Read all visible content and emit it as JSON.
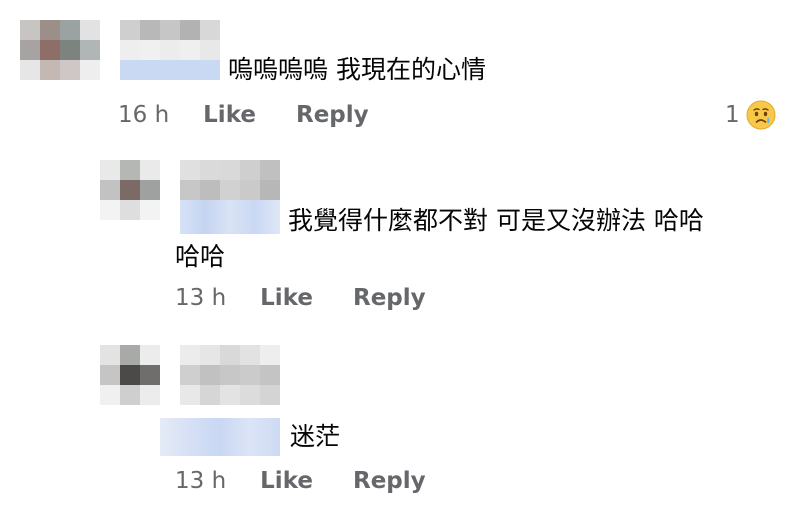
{
  "comments": [
    {
      "text": "嗚嗚嗚嗚 我現在的心情",
      "time": "16 h",
      "like": "Like",
      "reply": "Reply",
      "reaction_count": "1",
      "reaction_icon": "crying-face-icon"
    },
    {
      "text_line1": "我覺得什麼都不對 可是又沒辦法 哈哈",
      "text_line2": "哈哈",
      "time": "13 h",
      "like": "Like",
      "reply": "Reply"
    },
    {
      "text": "迷茫",
      "time": "13 h",
      "like": "Like",
      "reply": "Reply"
    }
  ],
  "colors": {
    "meta": "#65676b",
    "text": "#050505",
    "avatar_blur": "#9a9a9a",
    "name_blur": "#c9d8f3"
  }
}
